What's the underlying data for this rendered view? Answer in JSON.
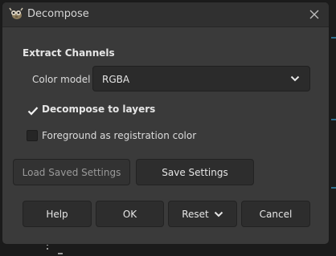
{
  "window": {
    "title": "Decompose",
    "icon": "gimp-wilber-icon",
    "close_icon": "close-icon"
  },
  "section": {
    "title": "Extract Channels"
  },
  "color_model": {
    "label": "Color model",
    "value": "RGBA"
  },
  "options": {
    "decompose_to_layers": {
      "label": "Decompose to layers",
      "checked": true
    },
    "foreground_registration": {
      "label": "Foreground as registration color",
      "checked": false
    }
  },
  "settings_buttons": {
    "load": "Load Saved Settings",
    "save": "Save Settings"
  },
  "action_buttons": {
    "help": "Help",
    "ok": "OK",
    "reset": "Reset",
    "cancel": "Cancel"
  },
  "colors": {
    "dialog_bg": "#3a3a3a",
    "titlebar_bg": "#303030",
    "button_bg": "#2d2d2d",
    "text": "#e6e6e6",
    "accent_line": "#2f6f8f"
  }
}
